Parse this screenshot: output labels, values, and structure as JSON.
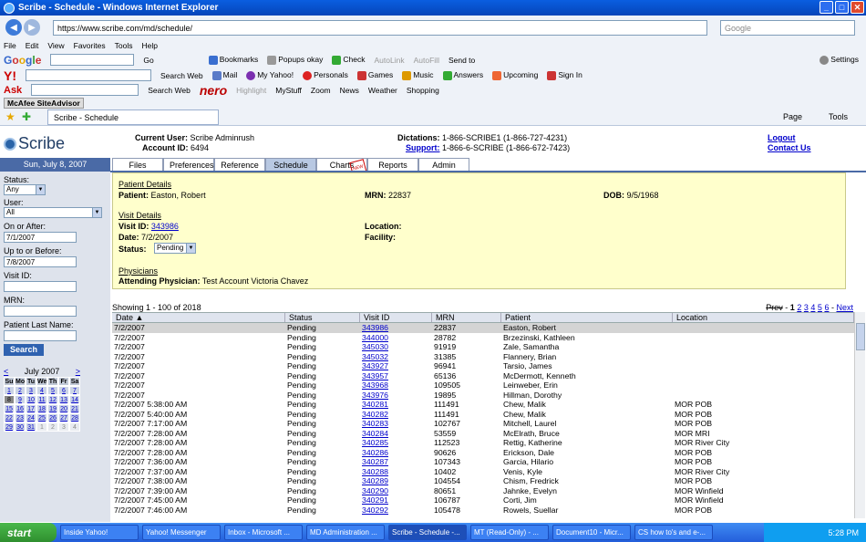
{
  "window": {
    "title": "Scribe - Schedule - Windows Internet Explorer"
  },
  "browser": {
    "url": "https://www.scribe.com/md/schedule/",
    "search_placeholder": "Google",
    "menu": [
      "File",
      "Edit",
      "View",
      "Favorites",
      "Tools",
      "Help"
    ],
    "google_toolbar": [
      "Go",
      "Bookmarks",
      "Popups okay",
      "Check",
      "AutoLink",
      "AutoFill",
      "Send to",
      "Settings"
    ],
    "yahoo_toolbar": [
      "Search Web",
      "Mail",
      "My Yahoo!",
      "Personals",
      "Games",
      "Music",
      "Answers",
      "Upcoming",
      "Sign In"
    ],
    "ask_toolbar": [
      "Search Web",
      "nero",
      "Highlight",
      "MyStuff",
      "Zoom",
      "News",
      "Weather",
      "Shopping"
    ],
    "mcafee": "McAfee SiteAdvisor",
    "tab_title": "Scribe - Schedule",
    "cmd": [
      "Page",
      "Tools"
    ]
  },
  "app": {
    "logo": "Scribe",
    "current_user_label": "Current User:",
    "current_user": "Scribe Adminrush",
    "account_label": "Account ID:",
    "account_id": "6494",
    "dictations_label": "Dictations:",
    "dictations": "1-866-SCRIBE1 (1-866-727-4231)",
    "support_label": "Support:",
    "support": "1-866-6-SCRIBE (1-866-672-7423)",
    "logout": "Logout",
    "contact": "Contact Us",
    "date": "Sun, July 8, 2007",
    "tabs": [
      "Files",
      "Preferences",
      "Reference",
      "Schedule",
      "Charts",
      "Reports",
      "Admin"
    ],
    "charts_badge": "NEW"
  },
  "filters": {
    "status_label": "Status:",
    "status_value": "Any",
    "user_label": "User:",
    "user_value": "All",
    "on_after_label": "On or After:",
    "on_after": "7/1/2007",
    "up_before_label": "Up to or Before:",
    "up_before": "7/8/2007",
    "visit_label": "Visit ID:",
    "mrn_label": "MRN:",
    "last_name_label": "Patient Last Name:",
    "search_btn": "Search"
  },
  "calendar": {
    "prev": "<",
    "next": ">",
    "month": "July 2007",
    "dow": [
      "Su",
      "Mo",
      "Tu",
      "We",
      "Th",
      "Fr",
      "Sa"
    ],
    "days": [
      "1",
      "2",
      "3",
      "4",
      "5",
      "6",
      "7",
      "8",
      "9",
      "10",
      "11",
      "12",
      "13",
      "14",
      "15",
      "16",
      "17",
      "18",
      "19",
      "20",
      "21",
      "22",
      "23",
      "24",
      "25",
      "26",
      "27",
      "28",
      "29",
      "30",
      "31",
      "1",
      "2",
      "3",
      "4"
    ],
    "other_start": 31,
    "today_index": 7
  },
  "details": {
    "patient_heading": "Patient Details",
    "patient_label": "Patient:",
    "patient": "Easton, Robert",
    "mrn_label": "MRN:",
    "mrn": "22837",
    "dob_label": "DOB:",
    "dob": "9/5/1968",
    "visit_heading": "Visit Details",
    "visit_label": "Visit ID:",
    "visit_id": "343986",
    "date_label": "Date:",
    "date": "7/2/2007",
    "status_label": "Status:",
    "status": "Pending",
    "location_label": "Location:",
    "facility_label": "Facility:",
    "physicians_heading": "Physicians",
    "attending_label": "Attending Physician:",
    "attending": "Test Account Victoria Chavez"
  },
  "table": {
    "showing": "Showing 1 - 100 of 2018",
    "pager": {
      "prev": "Prev",
      "pages": [
        "1",
        "2",
        "3",
        "4",
        "5",
        "6"
      ],
      "sep": "-",
      "next": "Next"
    },
    "headers": [
      "Date",
      "Status",
      "Visit ID",
      "MRN",
      "Patient",
      "Location"
    ],
    "rows": [
      [
        "7/2/2007",
        "Pending",
        "343986",
        "22837",
        "Easton, Robert",
        ""
      ],
      [
        "7/2/2007",
        "Pending",
        "344000",
        "28782",
        "Brzezinski, Kathleen",
        ""
      ],
      [
        "7/2/2007",
        "Pending",
        "345030",
        "91919",
        "Zale, Samantha",
        ""
      ],
      [
        "7/2/2007",
        "Pending",
        "345032",
        "31385",
        "Flannery, Brian",
        ""
      ],
      [
        "7/2/2007",
        "Pending",
        "343927",
        "96941",
        "Tarsio, James",
        ""
      ],
      [
        "7/2/2007",
        "Pending",
        "343957",
        "65136",
        "McDermott, Kenneth",
        ""
      ],
      [
        "7/2/2007",
        "Pending",
        "343968",
        "109505",
        "Leinweber, Erin",
        ""
      ],
      [
        "7/2/2007",
        "Pending",
        "343976",
        "19895",
        "Hillman, Dorothy",
        ""
      ],
      [
        "7/2/2007 5:38:00 AM",
        "Pending",
        "340281",
        "111491",
        "Chew, Malik",
        "MOR POB"
      ],
      [
        "7/2/2007 5:40:00 AM",
        "Pending",
        "340282",
        "111491",
        "Chew, Malik",
        "MOR POB"
      ],
      [
        "7/2/2007 7:17:00 AM",
        "Pending",
        "340283",
        "102767",
        "Mitchell, Laurel",
        "MOR POB"
      ],
      [
        "7/2/2007 7:28:00 AM",
        "Pending",
        "340284",
        "53559",
        "McElrath, Bruce",
        "MOR MRI"
      ],
      [
        "7/2/2007 7:28:00 AM",
        "Pending",
        "340285",
        "112523",
        "Rettig, Katherine",
        "MOR River City"
      ],
      [
        "7/2/2007 7:28:00 AM",
        "Pending",
        "340286",
        "90626",
        "Erickson, Dale",
        "MOR POB"
      ],
      [
        "7/2/2007 7:36:00 AM",
        "Pending",
        "340287",
        "107343",
        "Garcia, Hilario",
        "MOR POB"
      ],
      [
        "7/2/2007 7:37:00 AM",
        "Pending",
        "340288",
        "10402",
        "Venis, Kyle",
        "MOR River City"
      ],
      [
        "7/2/2007 7:38:00 AM",
        "Pending",
        "340289",
        "104554",
        "Chism, Fredrick",
        "MOR POB"
      ],
      [
        "7/2/2007 7:39:00 AM",
        "Pending",
        "340290",
        "80651",
        "Jahnke, Evelyn",
        "MOR Winfield"
      ],
      [
        "7/2/2007 7:45:00 AM",
        "Pending",
        "340291",
        "106787",
        "Corti, Jim",
        "MOR Winfield"
      ],
      [
        "7/2/2007 7:46:00 AM",
        "Pending",
        "340292",
        "105478",
        "Rowels, Suellar",
        "MOR POB"
      ]
    ]
  },
  "taskbar": {
    "start": "start",
    "items": [
      "Inside Yahoo!",
      "Yahoo! Messenger",
      "Inbox - Microsoft ...",
      "MD Administration ...",
      "Scribe - Schedule -...",
      "MT (Read-Only) - ...",
      "Document10 - Micr...",
      "CS how to's and e-..."
    ],
    "active_index": 4,
    "clock": "5:28 PM"
  }
}
